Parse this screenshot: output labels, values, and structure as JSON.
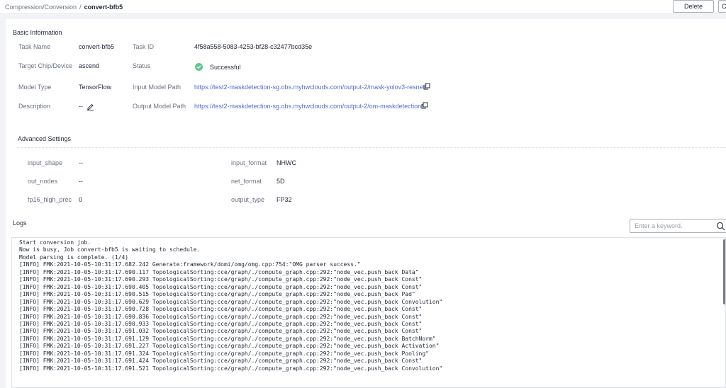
{
  "breadcrumb": {
    "parent": "Compression/Conversion",
    "separator": "/",
    "current": "convert-bfb5"
  },
  "toolbar": {
    "delete_label": "Delete",
    "extra_label": "C"
  },
  "basic_info": {
    "title": "Basic Information",
    "task_name_label": "Task Name",
    "task_name": "convert-bfb5",
    "task_id_label": "Task ID",
    "task_id": "4f58a558-5083-4253-bf28-c32477bcd35e",
    "target_label": "Target Chip/Device",
    "target": "ascend",
    "status_label": "Status",
    "status": "Successful",
    "model_type_label": "Model Type",
    "model_type": "TensorFlow",
    "input_path_label": "Input Model Path",
    "input_path": "https://test2-maskdetection-sg.obs.myhwclouds.com/output-2/mask-yolov3-resnet/",
    "description_label": "Description",
    "description": "--",
    "output_path_label": "Output Model Path",
    "output_path": "https://test2-maskdetection-sg.obs.myhwclouds.com/output-2/om-maskdetection/"
  },
  "advanced": {
    "title": "Advanced Settings",
    "input_shape_label": "input_shape",
    "input_shape": "--",
    "input_format_label": "input_format",
    "input_format": "NHWC",
    "out_nodes_label": "out_nodes",
    "out_nodes": "--",
    "net_format_label": "net_format",
    "net_format": "5D",
    "fp16_label": "fp16_high_prec",
    "fp16": "0",
    "output_type_label": "output_type",
    "output_type": "FP32"
  },
  "logs": {
    "title": "Logs",
    "search_placeholder": "Enter a keyword.",
    "lines": [
      "Start conversion job.",
      "Now is busy, Job convert-bfb5 is waiting to schedule.",
      "Model parsing is complete. (1/4)",
      "[INFO] FMK:2021-10-05-10:31:17.682.242 Generate:framework/domi/omg/omg.cpp:754:\"OMG parser success.\"",
      "[INFO] FMK:2021-10-05-10:31:17.690.117 TopologicalSorting:cce/graph/./compute_graph.cpp:292:\"node_vec.push_back Data\"",
      "[INFO] FMK:2021-10-05-10:31:17.690.293 TopologicalSorting:cce/graph/./compute_graph.cpp:292:\"node_vec.push_back Const\"",
      "[INFO] FMK:2021-10-05-10:31:17.690.405 TopologicalSorting:cce/graph/./compute_graph.cpp:292:\"node_vec.push_back Const\"",
      "[INFO] FMK:2021-10-05-10:31:17.690.515 TopologicalSorting:cce/graph/./compute_graph.cpp:292:\"node_vec.push_back Pad\"",
      "[INFO] FMK:2021-10-05-10:31:17.690.629 TopologicalSorting:cce/graph/./compute_graph.cpp:292:\"node_vec.push_back Convolution\"",
      "[INFO] FMK:2021-10-05-10:31:17.690.728 TopologicalSorting:cce/graph/./compute_graph.cpp:292:\"node_vec.push_back Const\"",
      "[INFO] FMK:2021-10-05-10:31:17.690.836 TopologicalSorting:cce/graph/./compute_graph.cpp:292:\"node_vec.push_back Const\"",
      "[INFO] FMK:2021-10-05-10:31:17.690.933 TopologicalSorting:cce/graph/./compute_graph.cpp:292:\"node_vec.push_back Const\"",
      "[INFO] FMK:2021-10-05-10:31:17.691.032 TopologicalSorting:cce/graph/./compute_graph.cpp:292:\"node_vec.push_back Const\"",
      "[INFO] FMK:2021-10-05-10:31:17.691.129 TopologicalSorting:cce/graph/./compute_graph.cpp:292:\"node_vec.push_back BatchNorm\"",
      "[INFO] FMK:2021-10-05-10:31:17.691.227 TopologicalSorting:cce/graph/./compute_graph.cpp:292:\"node_vec.push_back Activation\"",
      "[INFO] FMK:2021-10-05-10:31:17.691.324 TopologicalSorting:cce/graph/./compute_graph.cpp:292:\"node_vec.push_back Pooling\"",
      "[INFO] FMK:2021-10-05-10:31:17.691.424 TopologicalSorting:cce/graph/./compute_graph.cpp:292:\"node_vec.push_back Const\"",
      "[INFO] FMK:2021-10-05-10:31:17.691.521 TopologicalSorting:cce/graph/./compute_graph.cpp:292:\"node_vec.push_back Convolution\""
    ]
  },
  "colors": {
    "accent": "#526ecc",
    "success": "#5fc98f",
    "page_bg": "#f1f3f7"
  },
  "icons": {
    "copy": "copy-icon",
    "edit": "edit-icon",
    "search": "search-icon",
    "status": "check-circle-icon"
  }
}
